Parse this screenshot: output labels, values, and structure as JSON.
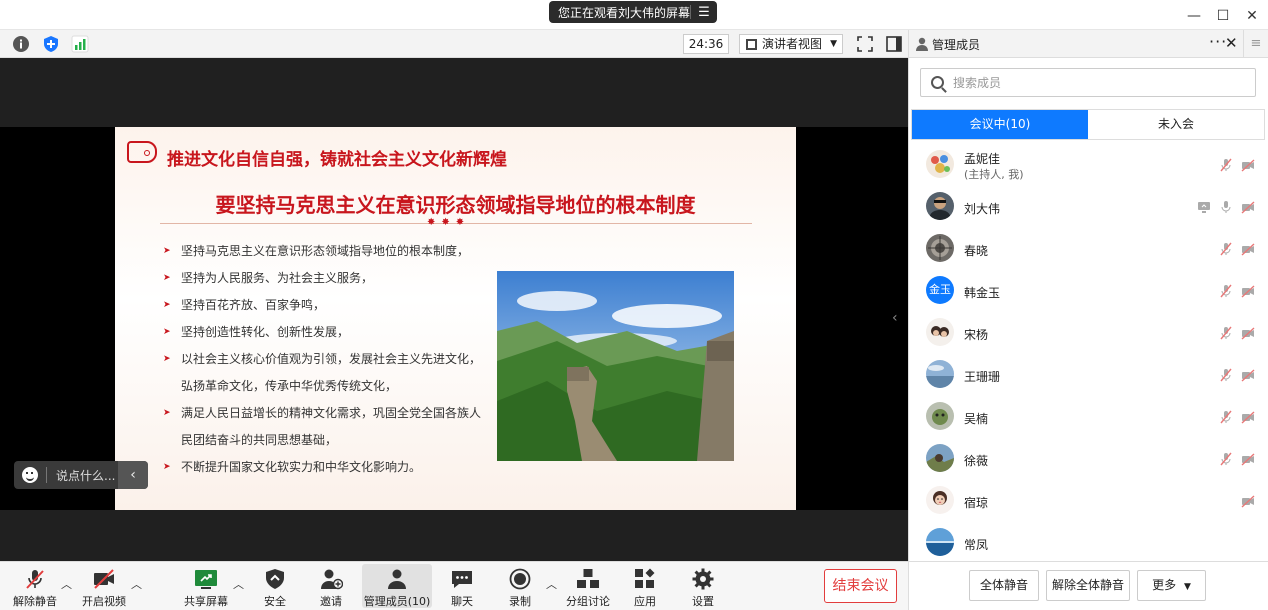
{
  "window": {
    "share_banner": "您正在观看刘大伟的屏幕",
    "banner_menu_icon": "menu-icon",
    "controls": [
      "minimize-icon",
      "maximize-icon",
      "close-icon"
    ]
  },
  "toolbar": {
    "timer": "24:36",
    "view_mode": "演讲者视图",
    "icons": [
      "info-icon",
      "shield-icon",
      "signal-icon",
      "fullscreen-icon",
      "side-panel-icon"
    ]
  },
  "slide": {
    "header": "推进文化自信自强，铸就社会主义文化新辉煌",
    "title": "要坚持马克思主义在意识形态领域指导地位的根本制度",
    "bullets": [
      "坚持马克思主义在意识形态领域指导地位的根本制度，",
      "坚持为人民服务、为社会主义服务，",
      "坚持百花齐放、百家争鸣，",
      "坚持创造性转化、创新性发展，",
      "以社会主义核心价值观为引领，发展社会主义先进文化，弘扬革命文化，传承中华优秀传统文化，",
      "满足人民日益增长的精神文化需求，巩固全党全国各族人民团结奋斗的共同思想基础，",
      "不断提升国家文化软实力和中华文化影响力。"
    ],
    "image_icon": "great-wall-photo"
  },
  "chat": {
    "placeholder": "说点什么..."
  },
  "bottom_bar": {
    "unmute": "解除静音",
    "start_video": "开启视频",
    "share_screen": "共享屏幕",
    "security": "安全",
    "invite": "邀请",
    "manage_members": "管理成员(10)",
    "chat": "聊天",
    "record": "录制",
    "breakout": "分组讨论",
    "apps": "应用",
    "settings": "设置",
    "end_meeting": "结束会议",
    "accent_red": "#e23d3d"
  },
  "panel": {
    "title": "管理成员",
    "search_placeholder": "搜索成员",
    "tab_in_meeting": "会议中(10)",
    "tab_not_joined": "未入会",
    "accent": "#0e7aff",
    "members": [
      {
        "name": "孟妮佳",
        "role": "(主持人, 我)",
        "mic": "muted",
        "video": "off"
      },
      {
        "name": "刘大伟",
        "role": "",
        "mic": "on",
        "video": "off",
        "sharing": true
      },
      {
        "name": "春晓",
        "role": "",
        "mic": "muted",
        "video": "off"
      },
      {
        "name": "韩金玉",
        "role": "",
        "avatar_text": "金玉",
        "mic": "muted",
        "video": "off"
      },
      {
        "name": "宋杨",
        "role": "",
        "mic": "muted",
        "video": "off"
      },
      {
        "name": "王珊珊",
        "role": "",
        "mic": "muted",
        "video": "off"
      },
      {
        "name": "吴楠",
        "role": "",
        "mic": "muted",
        "video": "off"
      },
      {
        "name": "徐薇",
        "role": "",
        "mic": "muted",
        "video": "off"
      },
      {
        "name": "宿琼",
        "role": "",
        "mic": "",
        "video": "off"
      },
      {
        "name": "常凤",
        "role": "",
        "mic": "",
        "video": ""
      }
    ],
    "mute_all": "全体静音",
    "unmute_all": "解除全体静音",
    "more": "更多"
  }
}
